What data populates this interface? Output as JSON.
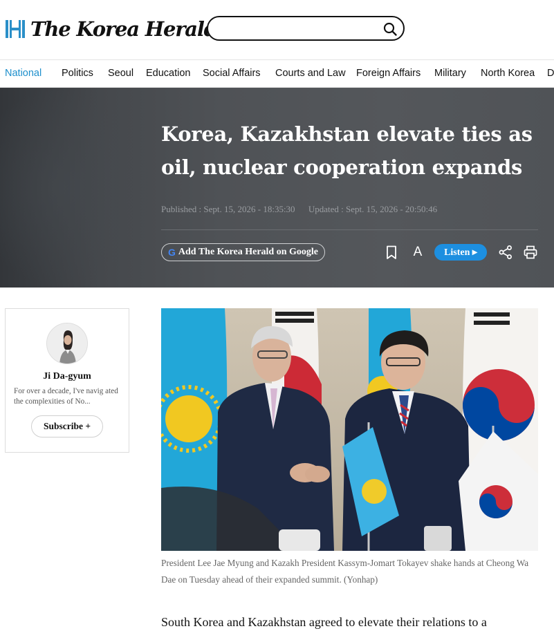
{
  "header": {
    "logo_text": "The Korea Herald",
    "search": {
      "placeholder": ""
    }
  },
  "nav": {
    "items": [
      {
        "label": "National",
        "active": true
      },
      {
        "label": "Politics"
      },
      {
        "label": "Seoul"
      },
      {
        "label": "Education"
      },
      {
        "label": "Social Affairs"
      },
      {
        "label": "Courts and Law"
      },
      {
        "label": "Foreign Affairs"
      },
      {
        "label": "Military"
      },
      {
        "label": "North Korea"
      },
      {
        "label": "D"
      }
    ]
  },
  "article": {
    "headline": "Korea, Kazakhstan elevate ties as oil, nuclear cooperation expands",
    "published": "Published : Sept. 15, 2026 - 18:35:30",
    "updated": "Updated : Sept. 15, 2026 - 20:50:46",
    "google_button": "Add The Korea Herald on Google",
    "google_glyph": "G",
    "listen_label": "Listen ▸",
    "font_size_glyph": "A",
    "caption": "President Lee Jae Myung and Kazakh President Kassym-Jomart Tokayev shake hands at Cheong Wa Dae on Tuesday ahead of their expanded summit. (Yonhap)",
    "lead": "South Korea and Kazakhstan agreed to elevate their relations to a"
  },
  "author": {
    "name": "Ji Da-gyum",
    "bio": "For over a decade, I've navig ated the complexities of No...",
    "subscribe_label": "Subscribe +"
  },
  "colors": {
    "accent": "#1d8fcc",
    "listen": "#1d8fe0",
    "hero_bg": "#4f5256"
  },
  "icons": [
    "korea-herald-logo-icon",
    "search-icon",
    "google-g-icon",
    "bookmark-icon",
    "font-size-icon",
    "share-icon",
    "print-icon"
  ]
}
